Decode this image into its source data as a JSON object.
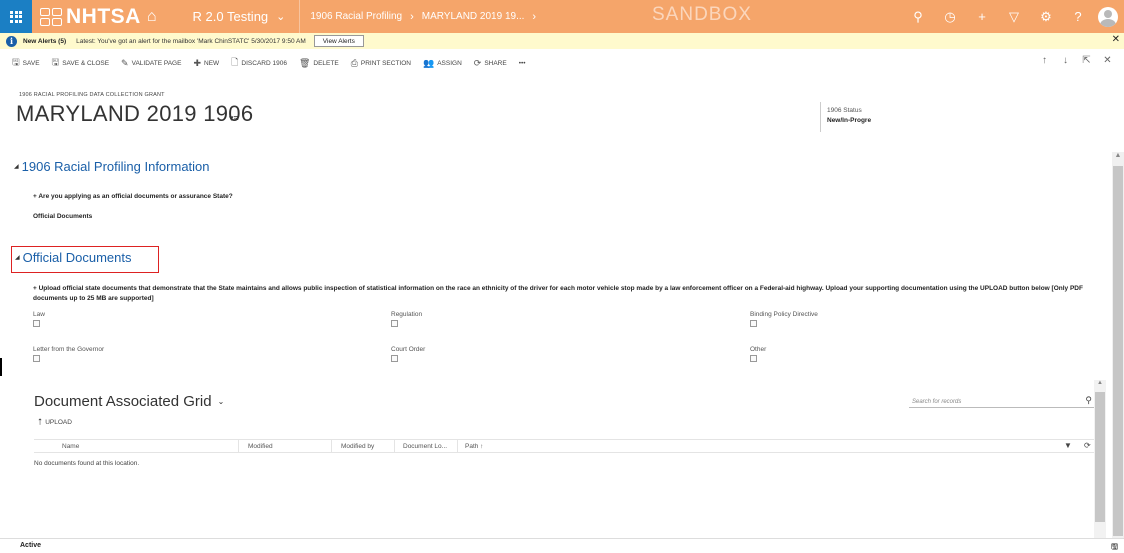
{
  "nav": {
    "logo_text": "NHTSA",
    "app_name": "R 2.0 Testing",
    "breadcrumb": [
      "1906 Racial Profiling",
      "MARYLAND 2019 19..."
    ],
    "environment": "SANDBOX",
    "icons": [
      "search-icon",
      "history-icon",
      "plus-icon",
      "filter-icon",
      "gear-icon",
      "help-icon",
      "user-avatar"
    ]
  },
  "alert": {
    "title": "New Alerts (5)",
    "message": "Latest: You've got an alert for the mailbox 'Mark ChinSTATC' 5/30/2017 9:50 AM",
    "button": "View Alerts",
    "close": "✕"
  },
  "commands": [
    {
      "icon": "save-icon",
      "glyph": "🖫",
      "label": "SAVE"
    },
    {
      "icon": "save-close-icon",
      "glyph": "🖫",
      "label": "SAVE & CLOSE"
    },
    {
      "icon": "validate-icon",
      "glyph": "✎",
      "label": "VALIDATE PAGE"
    },
    {
      "icon": "plus-icon",
      "glyph": "✚",
      "label": "NEW"
    },
    {
      "icon": "discard-icon",
      "glyph": "🗋",
      "label": "DISCARD 1906"
    },
    {
      "icon": "trash-icon",
      "glyph": "🗑",
      "label": "DELETE"
    },
    {
      "icon": "print-icon",
      "glyph": "⎙",
      "label": "PRINT SECTION"
    },
    {
      "icon": "assign-icon",
      "glyph": "👥",
      "label": "ASSIGN"
    },
    {
      "icon": "share-icon",
      "glyph": "⟳",
      "label": "SHARE"
    },
    {
      "icon": "more-icon",
      "glyph": "",
      "label": "•••"
    }
  ],
  "header": {
    "entity_type": "1906 RACIAL PROFILING DATA COLLECTION GRANT",
    "title": "MARYLAND 2019 1906",
    "status_label": "1906 Status",
    "status_value": "New/In-Progre"
  },
  "section1": {
    "title": "1906 Racial Profiling Information",
    "question": "+ Are you applying as an official documents or assurance State?",
    "answer": "Official Documents"
  },
  "section2": {
    "title": "Official Documents",
    "instructions": "+ Upload official state documents that demonstrate that the State maintains and allows public inspection of statistical information on the race an ethnicity of the driver for each motor vehicle stop made by a law enforcement officer on a Federal-aid highway. Upload your supporting documentation using the UPLOAD button below [Only PDF documents up to 25 MB are supported]",
    "checkboxes": [
      {
        "label": "Law",
        "checked": false
      },
      {
        "label": "Regulation",
        "checked": false
      },
      {
        "label": "Binding Policy Directive",
        "checked": false
      },
      {
        "label": "Letter from the Governor",
        "checked": false
      },
      {
        "label": "Court Order",
        "checked": false
      },
      {
        "label": "Other",
        "checked": false
      }
    ]
  },
  "grid": {
    "title": "Document Associated Grid",
    "upload_label": "UPLOAD",
    "search_placeholder": "Search for records",
    "columns": [
      "Name",
      "Modified",
      "Modified by",
      "Document Lo...",
      "Path ↑"
    ],
    "empty_message": "No documents found at this location."
  },
  "footer": {
    "status": "Active"
  }
}
